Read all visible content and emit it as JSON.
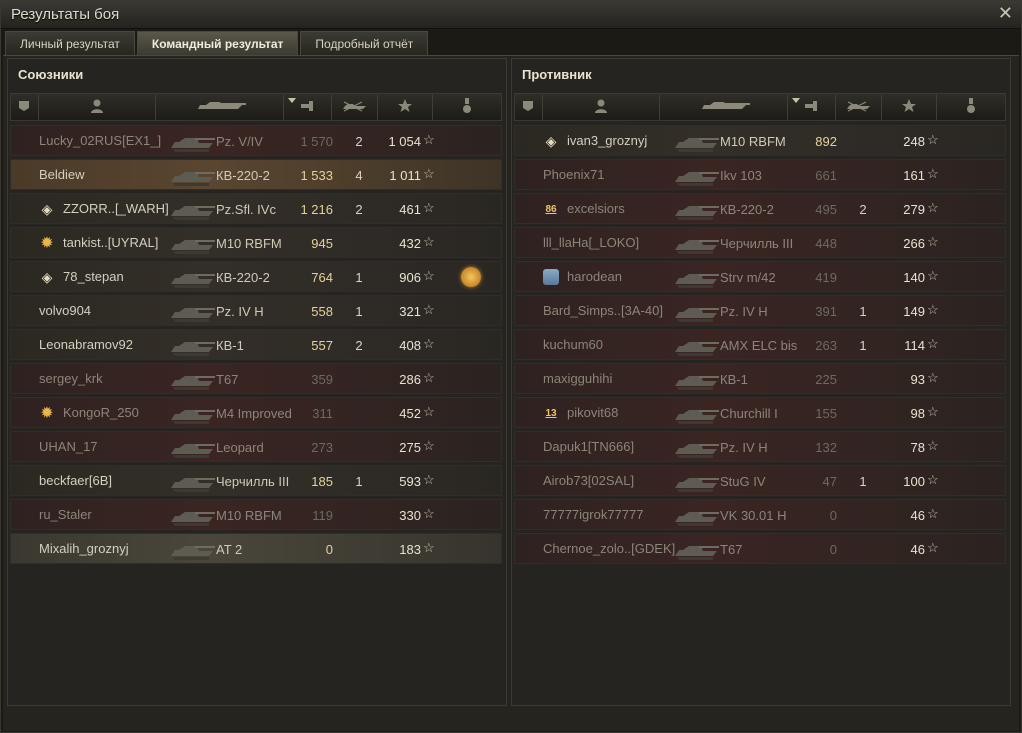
{
  "window": {
    "title": "Результаты боя",
    "close_symbol": "✕"
  },
  "tabs": [
    {
      "label": "Личный результат",
      "active": false
    },
    {
      "label": "Командный результат",
      "active": true
    },
    {
      "label": "Подробный отчёт",
      "active": false
    }
  ],
  "allies": {
    "title": "Союзники",
    "rows": [
      {
        "badge": "",
        "name": "Lucky_02RUS[EX1_]",
        "tank": "Pz. V/IV",
        "damage": "1 570",
        "kills": "2",
        "xp": "1 054",
        "state": "dead",
        "medal": false
      },
      {
        "badge": "",
        "name": "Beldiew",
        "tank": "КВ-220-2",
        "damage": "1 533",
        "kills": "4",
        "xp": "1 011",
        "state": "hot",
        "medal": false
      },
      {
        "badge": "diamond",
        "name": "ZZORR..[_WARH]",
        "tank": "Pz.Sfl. IVc",
        "damage": "1 216",
        "kills": "2",
        "xp": "461",
        "state": "",
        "medal": false
      },
      {
        "badge": "star",
        "name": "tankist..[UYRAL]",
        "tank": "M10 RBFM",
        "damage": "945",
        "kills": "",
        "xp": "432",
        "state": "",
        "medal": false
      },
      {
        "badge": "diamond",
        "name": "78_stepan",
        "tank": "КВ-220-2",
        "damage": "764",
        "kills": "1",
        "xp": "906",
        "state": "",
        "medal": true
      },
      {
        "badge": "",
        "name": "volvo904",
        "tank": "Pz. IV H",
        "damage": "558",
        "kills": "1",
        "xp": "321",
        "state": "",
        "medal": false
      },
      {
        "badge": "",
        "name": "Leonabramov92",
        "tank": "КВ-1",
        "damage": "557",
        "kills": "2",
        "xp": "408",
        "state": "",
        "medal": false
      },
      {
        "badge": "",
        "name": "sergey_krk",
        "tank": "T67",
        "damage": "359",
        "kills": "",
        "xp": "286",
        "state": "dead",
        "medal": false
      },
      {
        "badge": "star",
        "name": "KongoR_250",
        "tank": "M4 Improved",
        "damage": "311",
        "kills": "",
        "xp": "452",
        "state": "dead",
        "medal": false
      },
      {
        "badge": "",
        "name": "UHAN_17",
        "tank": "Leopard",
        "damage": "273",
        "kills": "",
        "xp": "275",
        "state": "dead",
        "medal": false
      },
      {
        "badge": "",
        "name": "beckfaer[6B]",
        "tank": "Черчилль III",
        "damage": "185",
        "kills": "1",
        "xp": "593",
        "state": "",
        "medal": false
      },
      {
        "badge": "",
        "name": "ru_Staler",
        "tank": "M10 RBFM",
        "damage": "119",
        "kills": "",
        "xp": "330",
        "state": "dead",
        "medal": false
      },
      {
        "badge": "",
        "name": "Mixalih_groznyj",
        "tank": "AT 2",
        "damage": "0",
        "kills": "",
        "xp": "183",
        "state": "me",
        "medal": false
      }
    ]
  },
  "enemies": {
    "title": "Противник",
    "rows": [
      {
        "badge": "diamond",
        "name": "ivan3_groznyj",
        "tank": "M10 RBFM",
        "damage": "892",
        "kills": "",
        "xp": "248",
        "state": ""
      },
      {
        "badge": "",
        "name": "Phoenix71",
        "tank": "Ikv 103",
        "damage": "661",
        "kills": "",
        "xp": "161",
        "state": "dead"
      },
      {
        "badge": "num",
        "badge_text": "86",
        "name": "excelsiors",
        "tank": "КВ-220-2",
        "damage": "495",
        "kills": "2",
        "xp": "279",
        "state": "dead"
      },
      {
        "badge": "",
        "name": "lll_llaHa[_LOKO]",
        "tank": "Черчилль III",
        "damage": "448",
        "kills": "",
        "xp": "266",
        "state": "dead"
      },
      {
        "badge": "shield",
        "name": "harodean",
        "tank": "Strv m/42",
        "damage": "419",
        "kills": "",
        "xp": "140",
        "state": "dead"
      },
      {
        "badge": "",
        "name": "Bard_Simps..[3A-40]",
        "tank": "Pz. IV H",
        "damage": "391",
        "kills": "1",
        "xp": "149",
        "state": "dead"
      },
      {
        "badge": "",
        "name": "kuchum60",
        "tank": "AMX ELC bis",
        "damage": "263",
        "kills": "1",
        "xp": "114",
        "state": "dead"
      },
      {
        "badge": "",
        "name": "maxigguhihi",
        "tank": "КВ-1",
        "damage": "225",
        "kills": "",
        "xp": "93",
        "state": "dead"
      },
      {
        "badge": "num",
        "badge_text": "13",
        "name": "pikovit68",
        "tank": "Churchill I",
        "damage": "155",
        "kills": "",
        "xp": "98",
        "state": "dead"
      },
      {
        "badge": "",
        "name": "Dapuk1[TN666]",
        "tank": "Pz. IV H",
        "damage": "132",
        "kills": "",
        "xp": "78",
        "state": "dead"
      },
      {
        "badge": "",
        "name": "Airob73[02SAL]",
        "tank": "StuG IV",
        "damage": "47",
        "kills": "1",
        "xp": "100",
        "state": "dead"
      },
      {
        "badge": "",
        "name": "77777igrok77777",
        "tank": "VK 30.01 H",
        "damage": "0",
        "kills": "",
        "xp": "46",
        "state": "dead"
      },
      {
        "badge": "",
        "name": "Chernoe_zolo..[GDEK]",
        "tank": "T67",
        "damage": "0",
        "kills": "",
        "xp": "46",
        "state": "dead"
      }
    ]
  },
  "header_icons": [
    "platoon-icon",
    "player-icon",
    "tank-icon",
    "damage-icon",
    "kills-icon",
    "xp-star-icon",
    "medal-icon"
  ],
  "star_symbol": "☆"
}
